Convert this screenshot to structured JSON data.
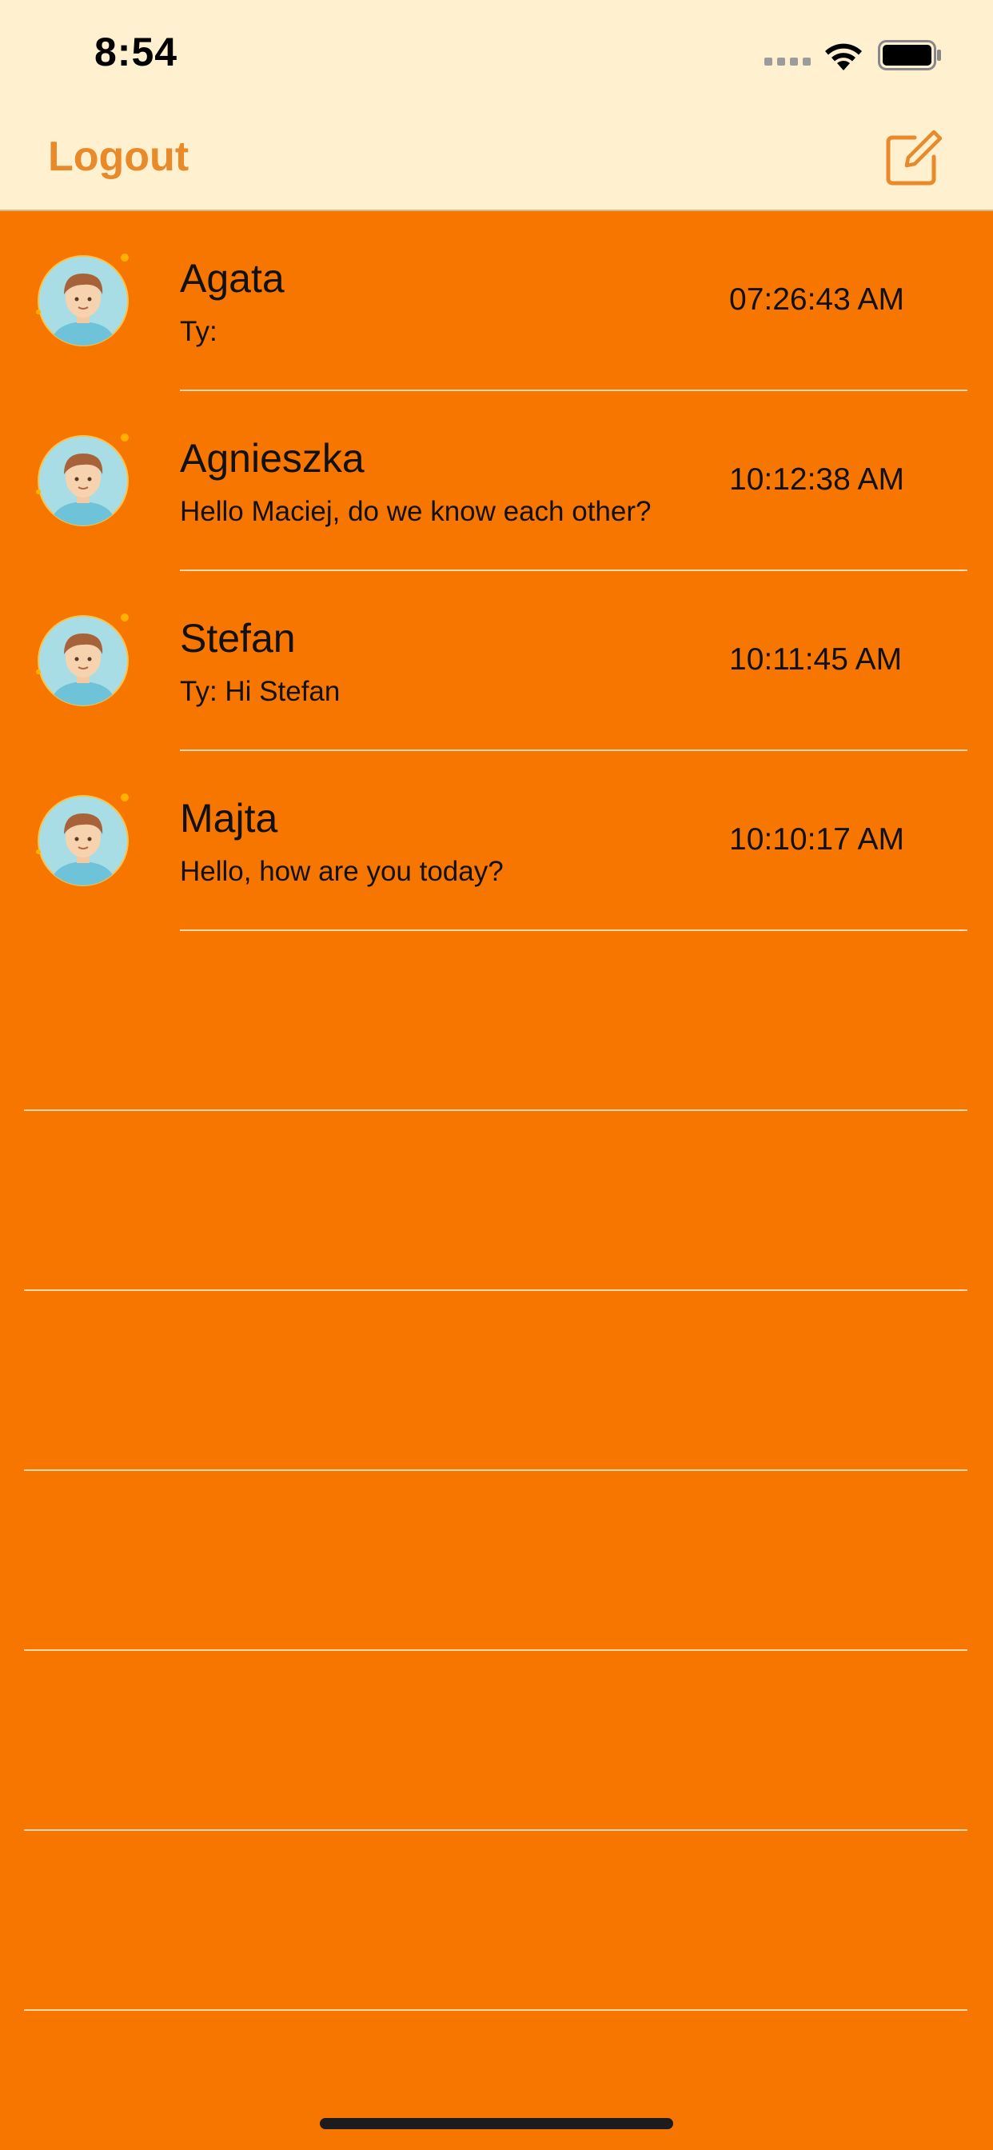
{
  "status_bar": {
    "time": "8:54"
  },
  "nav": {
    "logout_label": "Logout",
    "compose_icon": "compose-icon",
    "accent_color": "#E8892A"
  },
  "colors": {
    "background": "#F77600",
    "header_background": "#FFF0D0"
  },
  "chats": [
    {
      "name": "Agata",
      "preview": "Ty:",
      "time": "07:26:43 AM",
      "avatar_icon": "user-avatar-icon"
    },
    {
      "name": "Agnieszka",
      "preview": "Hello Maciej, do we know each other?",
      "time": "10:12:38 AM",
      "avatar_icon": "user-avatar-icon"
    },
    {
      "name": "Stefan",
      "preview": "Ty: Hi Stefan",
      "time": "10:11:45 AM",
      "avatar_icon": "user-avatar-icon"
    },
    {
      "name": "Majta",
      "preview": "Hello, how are you today?",
      "time": "10:10:17 AM",
      "avatar_icon": "user-avatar-icon"
    }
  ]
}
